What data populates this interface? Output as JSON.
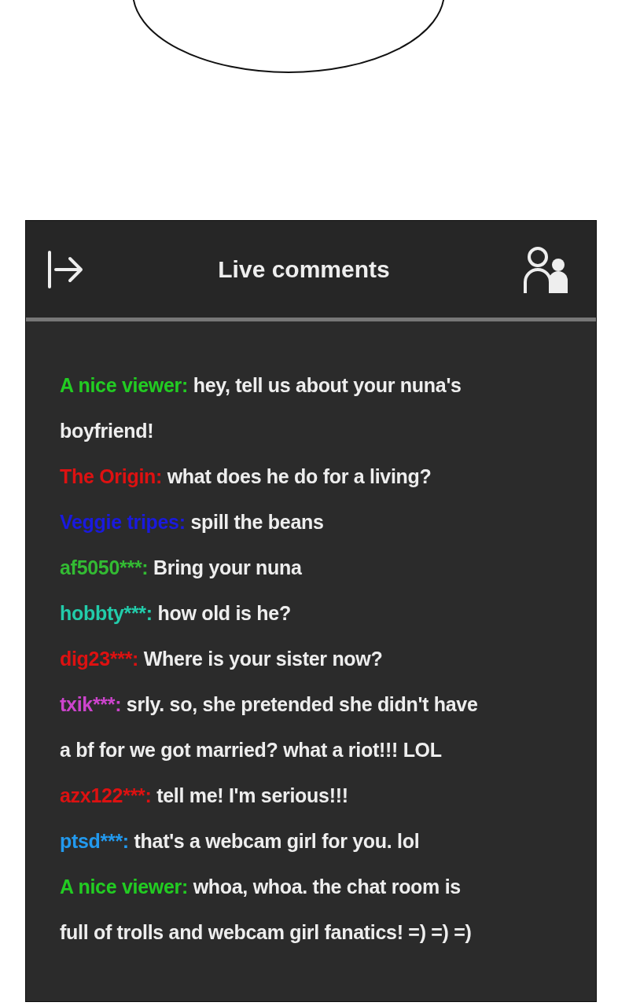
{
  "header": {
    "title": "Live comments"
  },
  "comments": [
    {
      "user": "A nice viewer:",
      "color": "#22cc22",
      "lines": [
        "hey, tell us about your nuna's",
        "boyfriend!"
      ]
    },
    {
      "user": "The Origin:",
      "color": "#dd1111",
      "lines": [
        "what does he do for a living?"
      ]
    },
    {
      "user": "Veggie tripes:",
      "color": "#1a1add",
      "lines": [
        "spill the beans"
      ]
    },
    {
      "user": "af5050***:",
      "color": "#33bb33",
      "lines": [
        "Bring your nuna"
      ]
    },
    {
      "user": "hobbty***:",
      "color": "#22ccaa",
      "lines": [
        "how old is he?"
      ]
    },
    {
      "user": "dig23***:",
      "color": "#dd1111",
      "lines": [
        "Where is your sister now?"
      ]
    },
    {
      "user": "txik***:",
      "color": "#cc44cc",
      "lines": [
        "srly. so, she pretended she didn't have",
        "a bf for we got married? what a riot!!! LOL"
      ]
    },
    {
      "user": "azx122***:",
      "color": "#dd1111",
      "lines": [
        "tell me! I'm serious!!!"
      ]
    },
    {
      "user": "ptsd***:",
      "color": "#2299ee",
      "lines": [
        "that's a webcam girl for you. lol"
      ]
    },
    {
      "user": "A nice viewer:",
      "color": "#22cc22",
      "lines": [
        "whoa, whoa. the chat room is",
        "full of trolls and webcam girl fanatics! =) =) =)"
      ]
    }
  ]
}
